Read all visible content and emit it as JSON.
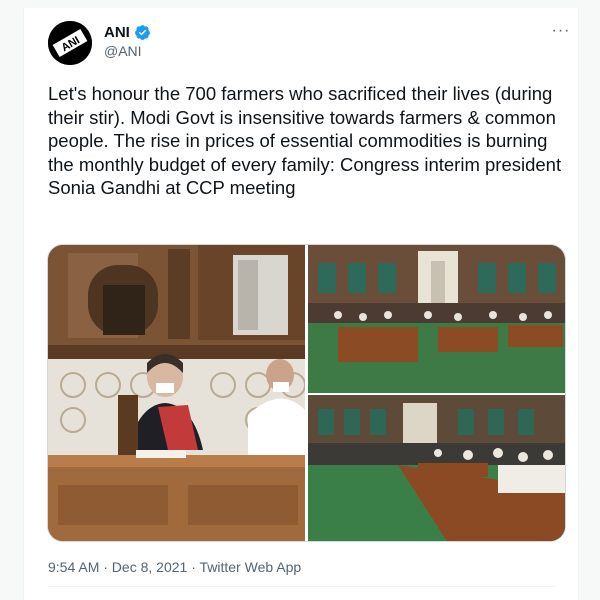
{
  "tweet": {
    "author_name": "ANI",
    "handle": "@ANI",
    "verified": true,
    "avatar_text": "ANI",
    "more_label": "···",
    "text": "Let's honour the 700 farmers who sacrificed their lives (during their stir). Modi Govt is insensitive towards farmers & common people. The rise in prices of essential commodities is burning the monthly budget of every family: Congress interim president Sonia Gandhi at CCP meeting",
    "meta": "9:54 AM · Dec 8, 2021 · Twitter Web App",
    "photo_count": 3
  },
  "colors": {
    "text": "#0f1419",
    "secondary": "#536471",
    "verified_blue": "#1d9bf0",
    "border": "#cfd9de"
  },
  "icons": {
    "verified": "verified-badge-icon",
    "more": "more-horizontal-icon"
  }
}
